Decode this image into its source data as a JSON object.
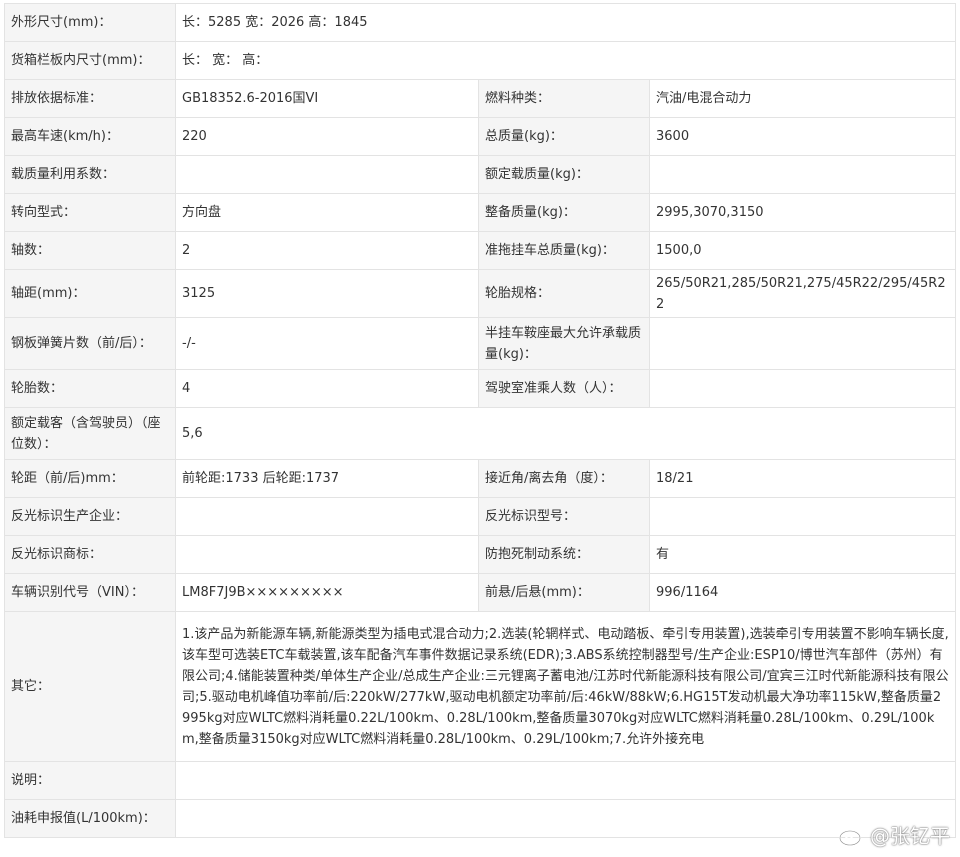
{
  "rows": [
    {
      "l1": "外形尺寸(mm)：",
      "v1": "长：5285 宽：2026 高：1845"
    },
    {
      "l1": "货箱栏板内尺寸(mm)：",
      "v1": "长： 宽： 高："
    },
    {
      "l1": "排放依据标准：",
      "v1": "GB18352.6-2016国VI",
      "l2": "燃料种类：",
      "v2": "汽油/电混合动力"
    },
    {
      "l1": "最高车速(km/h)：",
      "v1": "220",
      "l2": "总质量(kg)：",
      "v2": "3600"
    },
    {
      "l1": "载质量利用系数：",
      "v1": "",
      "l2": "额定载质量(kg)：",
      "v2": ""
    },
    {
      "l1": "转向型式：",
      "v1": "方向盘",
      "l2": "整备质量(kg)：",
      "v2": "2995,3070,3150"
    },
    {
      "l1": "轴数：",
      "v1": "2",
      "l2": "准拖挂车总质量(kg)：",
      "v2": "1500,0"
    },
    {
      "l1": "轴距(mm)：",
      "v1": "3125",
      "l2": "轮胎规格：",
      "v2": "265/50R21,285/50R21,275/45R22/295/45R22"
    },
    {
      "l1": "钢板弹簧片数（前/后）：",
      "v1": "-/-",
      "l2": "半挂车鞍座最大允许承载质量(kg)：",
      "v2": ""
    },
    {
      "l1": "轮胎数：",
      "v1": "4",
      "l2": "驾驶室准乘人数（人）：",
      "v2": ""
    },
    {
      "l1": "额定载客（含驾驶员）（座位数）：",
      "v1": "5,6"
    },
    {
      "l1": "轮距（前/后)mm：",
      "v1": "前轮距:1733 后轮距:1737",
      "l2": "接近角/离去角（度）：",
      "v2": "18/21"
    },
    {
      "l1": "反光标识生产企业：",
      "v1": "",
      "l2": "反光标识型号：",
      "v2": ""
    },
    {
      "l1": "反光标识商标：",
      "v1": "",
      "l2": "防抱死制动系统：",
      "v2": "有"
    },
    {
      "l1": "车辆识别代号（VIN）：",
      "v1": "LM8F7J9B×××××××××",
      "l2": "前悬/后悬(mm)：",
      "v2": "996/1164"
    },
    {
      "l1": "其它：",
      "v1": "1.该产品为新能源车辆,新能源类型为插电式混合动力;2.选装(轮辋样式、电动踏板、牵引专用装置),选装牵引专用装置不影响车辆长度,该车型可选装ETC车载装置,该车配备汽车事件数据记录系统(EDR);3.ABS系统控制器型号/生产企业:ESP10/博世汽车部件（苏州）有限公司;4.储能装置种类/单体生产企业/总成生产企业:三元锂离子蓄电池/江苏时代新能源科技有限公司/宜宾三江时代新能源科技有限公司;5.驱动电机峰值功率前/后:220kW/277kW,驱动电机额定功率前/后:46kW/88kW;6.HG15T发动机最大净功率115kW,整备质量2995kg对应WLTC燃料消耗量0.22L/100km、0.28L/100km,整备质量3070kg对应WLTC燃料消耗量0.28L/100km、0.29L/100km,整备质量3150kg对应WLTC燃料消耗量0.28L/100km、0.29L/100km;7.允许外接充电"
    },
    {
      "l1": "说明：",
      "v1": ""
    },
    {
      "l1": "油耗申报值(L/100km)：",
      "v1": ""
    }
  ],
  "watermark": {
    "text": "@张钇平",
    "icon": "weibo-icon"
  }
}
